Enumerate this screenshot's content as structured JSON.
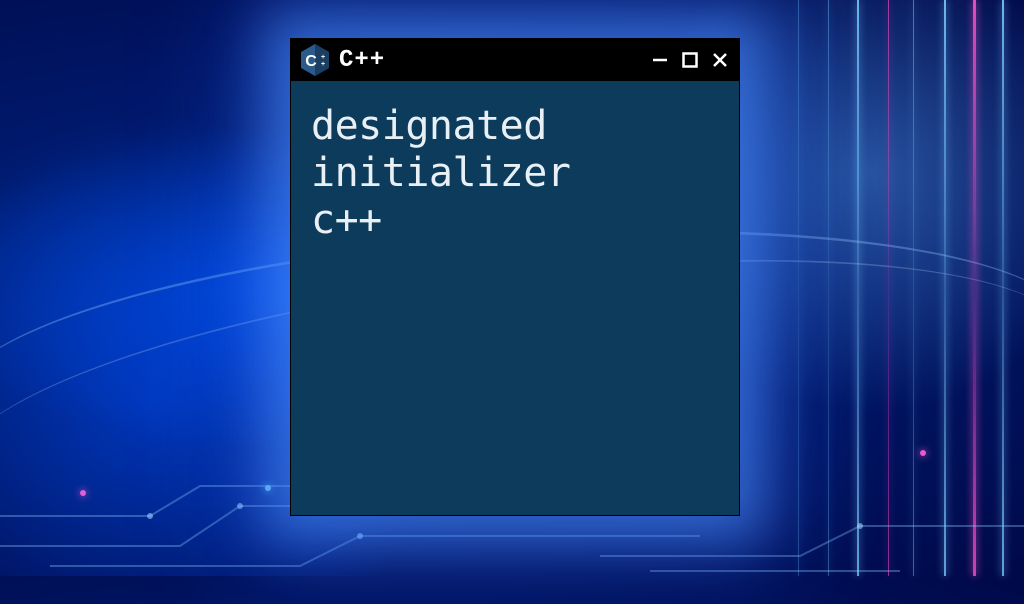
{
  "window": {
    "title": "C++",
    "logo_letter": "C",
    "logo_plus": "++"
  },
  "content": {
    "line1": "designated",
    "line2": "initializer",
    "line3": "c++"
  },
  "controls": {
    "minimize": "−",
    "maximize": "□",
    "close": "✕"
  }
}
